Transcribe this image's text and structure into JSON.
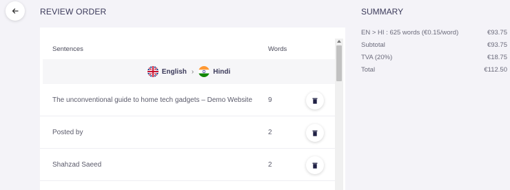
{
  "header": {
    "title": "REVIEW ORDER"
  },
  "table": {
    "col_sentences": "Sentences",
    "col_words": "Words",
    "source_lang": "English",
    "target_lang": "Hindi",
    "rows": [
      {
        "sentence": "The unconventional guide to home tech gadgets – Demo Website",
        "words": "9"
      },
      {
        "sentence": "Posted by",
        "words": "2"
      },
      {
        "sentence": "Shahzad Saeed",
        "words": "2"
      }
    ]
  },
  "summary": {
    "title": "SUMMARY",
    "lines": [
      {
        "label": "EN > HI : 625 words (€0.15/word)",
        "amount": "€93.75"
      },
      {
        "label": "Subtotal",
        "amount": "€93.75"
      },
      {
        "label": "TVA (20%)",
        "amount": "€18.75"
      },
      {
        "label": "Total",
        "amount": "€112.50"
      }
    ]
  },
  "icons": {
    "back": "arrow-left-icon",
    "delete": "trash-icon",
    "uk_flag": "uk-flag-icon",
    "india_flag": "india-flag-icon"
  },
  "colors": {
    "background": "#f4f3f8",
    "card": "#ffffff",
    "heading": "#3b3a5a",
    "delete_icon": "#1f2044"
  }
}
